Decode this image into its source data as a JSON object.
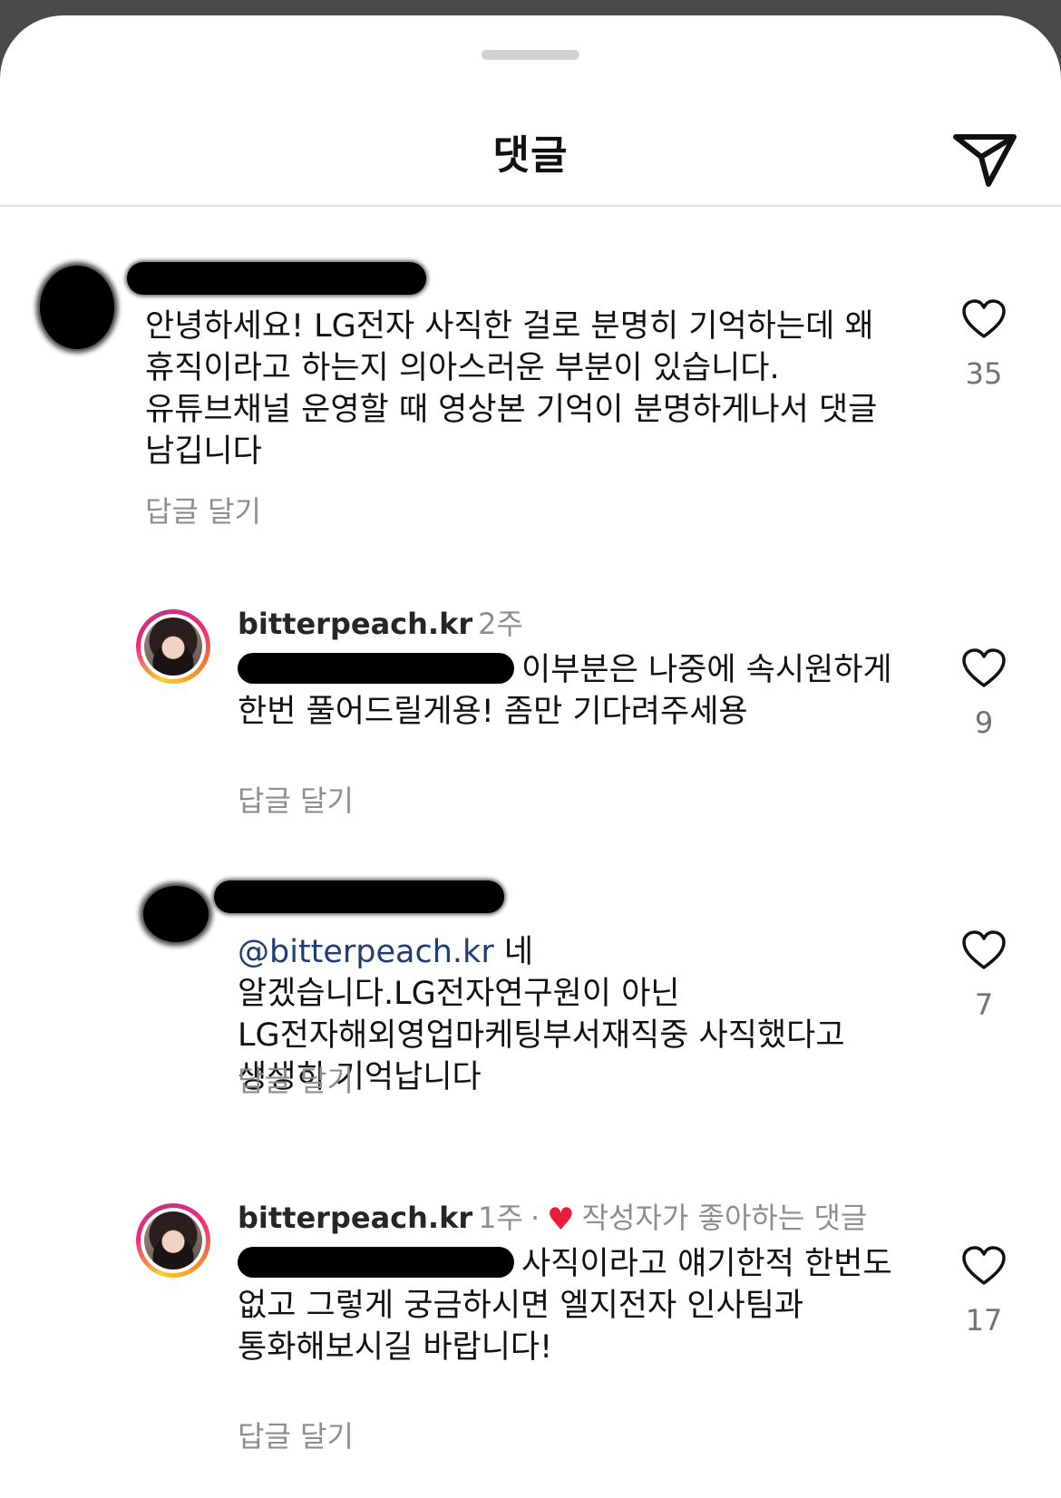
{
  "header": {
    "title": "댓글",
    "share_icon": "send-icon"
  },
  "comments": [
    {
      "username": "",
      "time": "",
      "mention": "",
      "text": "안녕하세요! LG전자 사직한 걸로 분명히 기억하는데 왜 휴직이라고 하는지 의아스러운 부분이 있습니다.유튜브채널 운영할 때 영상본 기억이 분명하게나서 댓글 남깁니다",
      "reply_label": "답글 달기",
      "likes": "35"
    },
    {
      "username": "bitterpeach.kr",
      "time": "2주",
      "mention": "",
      "text": "이부분은 나중에 속시원하게 한번 풀어드릴게용! 좀만 기다려주세용",
      "reply_label": "답글 달기",
      "likes": "9"
    },
    {
      "username": "",
      "time": "",
      "mention": "@bitterpeach.kr",
      "text": " 네 알겠습니다.LG전자연구원이 아닌 LG전자해외영업마케팅부서재직중 사직했다고 생생히 기억납니다",
      "reply_label": "답글 달기",
      "likes": "7"
    },
    {
      "username": "bitterpeach.kr",
      "time": "1주",
      "liked_by_author": "작성자가 좋아하는 댓글",
      "mention": "",
      "text": "사직이라고 얘기한적 한번도 없고 그렇게 궁금하시면 엘지전자 인사팀과 통화해보시길 바랍니다!",
      "reply_label": "답글 달기",
      "likes": "17"
    }
  ],
  "colors": {
    "mention": "#1f3e74",
    "secondary": "#8e8e8e",
    "heart": "#ed1c3b"
  }
}
